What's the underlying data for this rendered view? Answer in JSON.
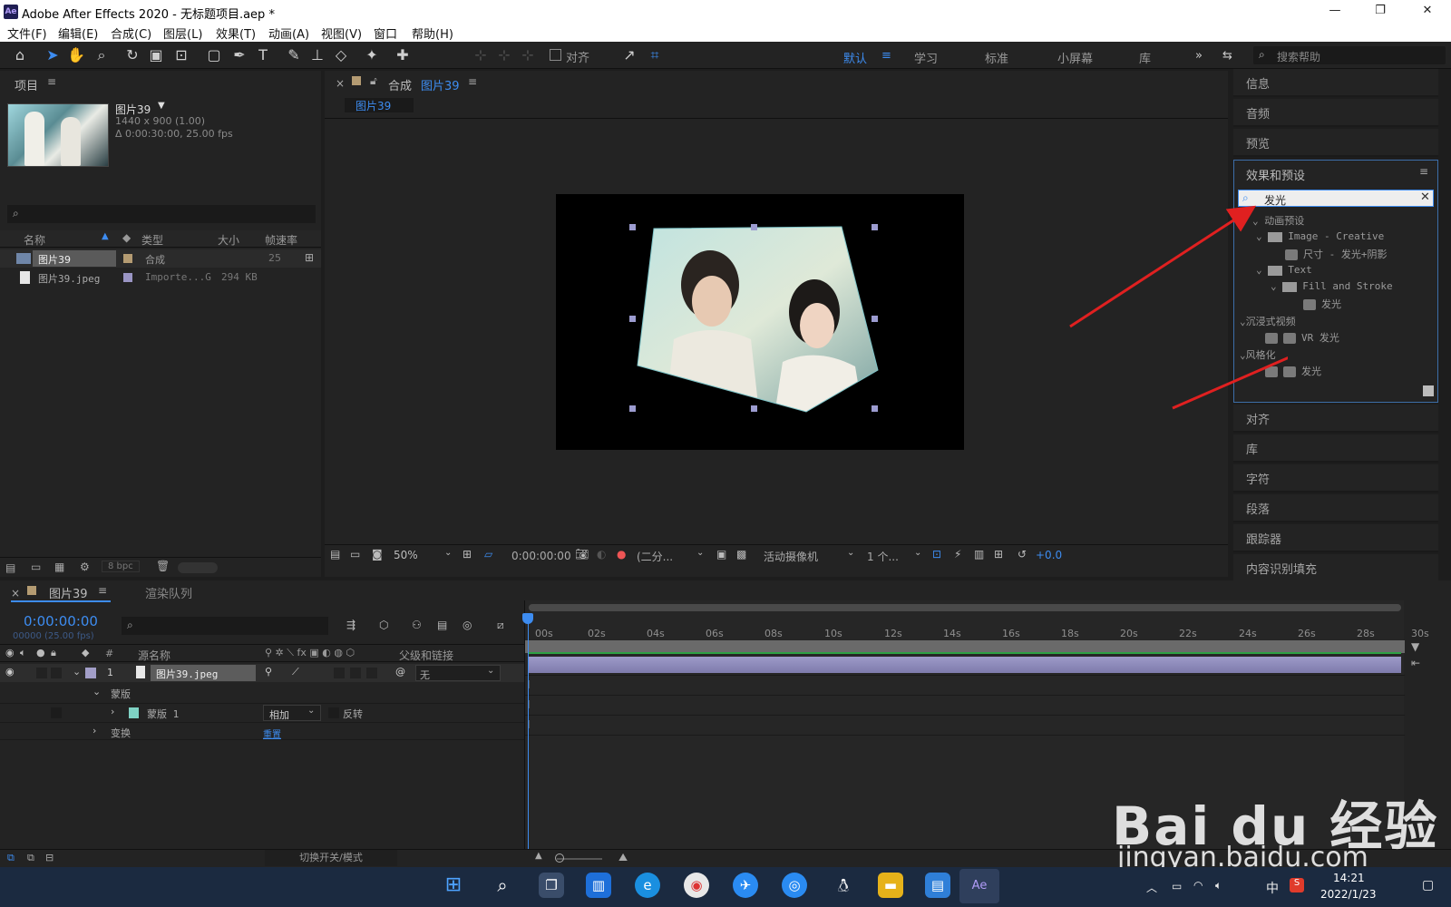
{
  "window": {
    "title": "Adobe After Effects 2020 - 无标题项目.aep *",
    "logo": "Ae",
    "controls": [
      "—",
      "❐",
      "✕"
    ]
  },
  "menu": [
    "文件(F)",
    "编辑(E)",
    "合成(C)",
    "图层(L)",
    "效果(T)",
    "动画(A)",
    "视图(V)",
    "窗口",
    "帮助(H)"
  ],
  "toolbar": {
    "align_label": "对齐",
    "workspaces": [
      "默认",
      "学习",
      "标准",
      "小屏幕",
      "库"
    ],
    "search_placeholder": "搜索帮助"
  },
  "project": {
    "title": "项目",
    "item_name": "图片39",
    "item_info1": "1440 x 900 (1.00)",
    "item_info2": "Δ 0:00:30:00, 25.00 fps",
    "columns": [
      "名称",
      "类型",
      "大小",
      "帧速率"
    ],
    "rows": [
      {
        "name": "图片39",
        "type": "合成",
        "size": "",
        "fps": "25"
      },
      {
        "name": "图片39.jpeg",
        "type": "Importe...G",
        "size": "294 KB",
        "fps": ""
      }
    ],
    "bpc": "8 bpc"
  },
  "comp": {
    "tab_label": "合成",
    "tab_name": "图片39",
    "sub_tab": "图片39",
    "zoom": "50%",
    "timecode": "0:00:00:00",
    "resolution": "(二分...",
    "camera": "活动摄像机",
    "views": "1 个...",
    "exposure": "+0.0"
  },
  "right_panel": {
    "top_items": [
      "信息",
      "音频",
      "预览"
    ],
    "effects_title": "效果和预设",
    "search_value": "发光",
    "tree": {
      "anim_presets": "动画预设",
      "image_creative": "Image - Creative",
      "preset1": "尺寸 - 发光+阴影",
      "text": "Text",
      "fill_stroke": "Fill and Stroke",
      "preset2": "发光",
      "immersive": "沉浸式视频",
      "vr_glow": "VR 发光",
      "stylize": "风格化",
      "glow": "发光"
    },
    "bottom_items": [
      "对齐",
      "库",
      "字符",
      "段落",
      "跟踪器",
      "内容识别填充"
    ]
  },
  "timeline": {
    "tab_name": "图片39",
    "render_queue": "渲染队列",
    "timecode": "0:00:00:00",
    "frame_info": "00000 (25.00 fps)",
    "col_source": "源名称",
    "col_parent": "父级和链接",
    "layer_index": "1",
    "layer_name": "图片39.jpeg",
    "parent_value": "无",
    "mask_group": "蒙版",
    "mask_name": "蒙版 1",
    "mask_mode": "相加",
    "invert_label": "反转",
    "transform": "变换",
    "reset": "重置",
    "ruler": [
      "00s",
      "02s",
      "04s",
      "06s",
      "08s",
      "10s",
      "12s",
      "14s",
      "16s",
      "18s",
      "20s",
      "22s",
      "24s",
      "26s",
      "28s",
      "30s"
    ],
    "toggle_modes": "切换开关/模式"
  },
  "taskbar": {
    "clock_time": "14:21",
    "clock_date": "2022/1/23",
    "ime": "中"
  },
  "watermark": {
    "brand": "Bai du 经验",
    "url": "jingyan.baidu.com"
  }
}
